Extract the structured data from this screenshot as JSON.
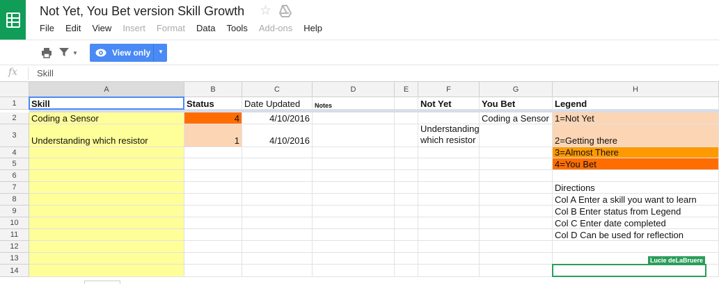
{
  "header": {
    "title": "Not Yet, You Bet version Skill Growth",
    "menu": [
      {
        "label": "File",
        "disabled": false
      },
      {
        "label": "Edit",
        "disabled": false
      },
      {
        "label": "View",
        "disabled": false
      },
      {
        "label": "Insert",
        "disabled": true
      },
      {
        "label": "Format",
        "disabled": true
      },
      {
        "label": "Data",
        "disabled": false
      },
      {
        "label": "Tools",
        "disabled": false
      },
      {
        "label": "Add-ons",
        "disabled": true
      },
      {
        "label": "Help",
        "disabled": false
      }
    ],
    "icons": {
      "app": "sheets-logo-icon",
      "star": "star-icon",
      "drive": "drive-icon"
    }
  },
  "toolbar": {
    "view_mode_label": "View only",
    "icons": [
      "print-icon",
      "filter-icon",
      "eye-icon"
    ]
  },
  "formula_bar": {
    "fx": "fx",
    "value": "Skill"
  },
  "colors": {
    "sheets_green": "#0f9d58",
    "button_blue": "#4a8af4",
    "yellow": "#ffff99",
    "dark_orange": "#ff6d00",
    "light_orange": "#fcd5b4",
    "orange": "#ff9900",
    "collab_green": "#2a9d5a"
  },
  "grid": {
    "columns": [
      "A",
      "B",
      "C",
      "D",
      "E",
      "F",
      "G",
      "H"
    ],
    "rows": [
      "1",
      "2",
      "3",
      "4",
      "5",
      "6",
      "7",
      "8",
      "9",
      "10",
      "11",
      "12",
      "13",
      "14"
    ],
    "cells": {
      "A1": "Skill",
      "B1": "Status",
      "C1": "Date Updated",
      "D1": "Notes",
      "F1": "Not Yet",
      "G1": "You Bet",
      "H1": "Legend",
      "A2": "Coding a Sensor",
      "B2": "4",
      "C2": "4/10/2016",
      "G2": "Coding a Sensor",
      "H2": "1=Not Yet",
      "A3": "Understanding which resistor",
      "B3": "1",
      "C3": "4/10/2016",
      "F3": "Understanding which resistor",
      "H3": "2=Getting there",
      "H4": "3=Almost There",
      "H5": "4=You Bet",
      "H7": "Directions",
      "H8": "Col A Enter a skill you want to learn",
      "H9": "Col B Enter status from Legend",
      "H10": "Col C Enter date completed",
      "H11": "Col D  Can be used for reflection"
    },
    "collaborator": "Lucie deLaBruere"
  }
}
